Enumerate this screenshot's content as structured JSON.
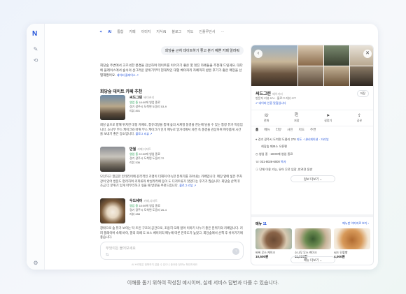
{
  "app": {
    "logo": "N"
  },
  "tabs": {
    "star": "✦",
    "ai": "AI",
    "items": [
      "통합",
      "카페",
      "이미지",
      "지식iN",
      "블로그",
      "지도",
      "인플루언서"
    ],
    "more": "···"
  },
  "chat": {
    "user_bubble": "회당숲 근처 데이트하기 좋고 분기 예쁜 카페 알려줘",
    "intro": "회당숲 주변에서 고즈넉한 풍경을 감상하며 데이트를 이어가기 좋은 몇 멋진 카페들을 추천해 드릴게요. 대다에 플레이스에서 숲속의 상그러운 분위기부터 현대적인 대형 베이커리 카페까지 받은 후기가 좋은 매장을 선별해봤어요.",
    "intro_source": "네이버 플레이스 ↗",
    "section_title": "회당숲 데이트 카페 추천",
    "places": [
      {
        "name": "씨드그린",
        "category": "베이커리",
        "hours_label": "영업 중",
        "hours": "18:00에 영업 종료",
        "address": "경기 광주시 도척면 도웅리 53-9",
        "reviews": "리뷰 801",
        "desc": "회당 숲으로 향해 위치한 대형 카페로, 통유리창을 통해 숲의 사계절 풍경을 한눈에 담을 수 있는 통창 뷰가 특징입니다. 소나무 무스 케이크와 바위 무스 케이크가 인기 메뉴로 알가석에서 자연 속 풍경을 감상하며 여유롭게 시간을 보내기 좋은 장소입니다.",
        "desc_source": "블로그 리뷰 ↗"
      },
      {
        "name": "만월",
        "category": "카페,디저트",
        "hours_label": "영업 중",
        "hours": "22:00에 영업 종료",
        "address": "경기 광주시 도척면 도웅리 72",
        "reviews": "리뷰 536",
        "desc": "모던하고 깔끔한 인테리어에 감각적인 조명이 더해져 아늑한 분위기를 자아내는 카페입니다. 매장 앞에 넓은 주차장이 있어 방문도 편리하며 커피류와 바닐라라떼 등이 도 디저트류가 맛있다는 후기가 많습니다. 회당숲 산책 후 조금 더 분위기 있게 마무리하고 싶을 때 방문을 추천드립니다.",
        "desc_source": "블로그 리뷰 ↗"
      },
      {
        "name": "우드쉐어",
        "category": "카페,디저트",
        "hours_label": "영업 중",
        "hours": "18:00에 영업 종료",
        "address": "경기 광주시 도척면 도웅리 26-4",
        "reviews": "리뷰 658",
        "desc": "창밖으로 숲 뷰가 보이는 탁 트인 구조의 공간으로, 조용히 오래 앉아 이야기 나누기 좋은 분위기의 카페입니다. 커피 플레이버 숙제 바이, 말리 라떼 도 보스 베이커리 메뉴에 따른 만족도가 높았고, 회당숲에서 산책 후 쉬어가기에 좋습니다."
      }
    ],
    "input_placeholder": "무엇이든 물어보세요",
    "input_tune_icon": "⇆",
    "send_icon": "↑",
    "footer_note": "AI 브리핑은 정확하지 않을 수 있으니 중요한 정보는 확인하세요"
  },
  "panel": {
    "back": "‹",
    "close": "✕",
    "name": "씨드그린",
    "category": "베이커리",
    "info": "방문자 리뷰 574 · 블로그 리뷰 277",
    "badge": "네이버 인증 맛집입니다",
    "save_label": "저장",
    "actions": [
      {
        "icon": "☏",
        "label": "전화"
      },
      {
        "icon": "⎘",
        "label": "저장"
      },
      {
        "icon": "➤",
        "label": "길찾기"
      },
      {
        "icon": "⇪",
        "label": "공유"
      }
    ],
    "tabs": [
      "홈",
      "메뉴",
      "리뷰",
      "사진",
      "지도",
      "주변"
    ],
    "details": [
      {
        "k": "주소",
        "v": "경기 광주시 도척면 도웅리 278",
        "link": "지도 · 내비게이션 · 거리뷰"
      },
      {
        "k": "",
        "v": "회당숲 매표소 오른편",
        "link": ""
      },
      {
        "k": "영업",
        "v": "영업 중 · 18:00에 영업 종료",
        "link": ""
      },
      {
        "k": "전화",
        "v": "031-8026-6000",
        "link": "복사"
      },
      {
        "k": "",
        "v": "단체 이용 가능, 유아 무료 입장, 반려견 동반",
        "link": ""
      }
    ],
    "more_label": "정보 더보기 ⌄",
    "menu_title": "메뉴",
    "menu_count": "11",
    "menu_link": "메뉴판 이미지로 보기 ›",
    "menu": [
      {
        "name": "바위 무스 케이크",
        "price": "10,500원"
      },
      {
        "name": "소나무 무스 케이크",
        "price": "11,000원"
      },
      {
        "name": "씨드 단팥빵",
        "price": "4,000원"
      }
    ],
    "menu_more_label": "메뉴 더보기 ⌄"
  },
  "caption": "이해를 돕기 위하여 작성된 예시이며, 실제 서비스 답변과 다를 수 있습니다."
}
